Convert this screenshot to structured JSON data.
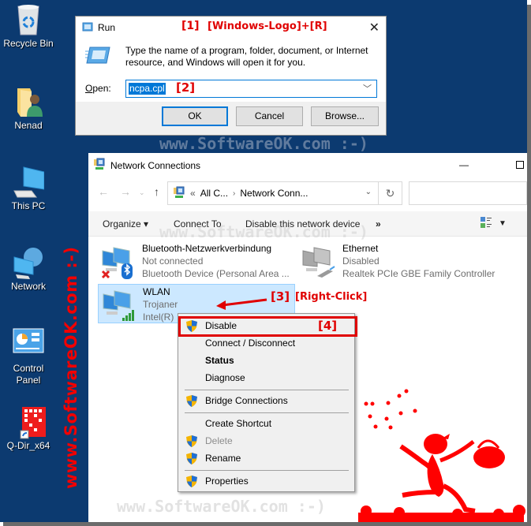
{
  "desktop": {
    "background_color": "#0c3a70",
    "icons": [
      {
        "label": "Recycle Bin",
        "icon": "recycle-bin-icon"
      },
      {
        "label": "Nenad",
        "icon": "user-folder-icon"
      },
      {
        "label": "This PC",
        "icon": "computer-icon"
      },
      {
        "label": "Network",
        "icon": "network-icon"
      },
      {
        "label": "Control Panel",
        "icon": "control-panel-icon"
      },
      {
        "label": "Q-Dir_x64",
        "icon": "qdir-shortcut-icon"
      }
    ]
  },
  "watermarks": {
    "side": "www.SoftwareOK.com :-)",
    "center": "www.SoftwareOK.com :-)"
  },
  "annotations": {
    "step1": "[1]",
    "step1_keys": "[Windows-Logo]+[R]",
    "step2": "[2]",
    "step3": "[3]",
    "step3_action": "[Right-Click]",
    "step4": "[4]",
    "color": "#e00000"
  },
  "run_dialog": {
    "title": "Run",
    "description": "Type the name of a program, folder, document, or Internet resource, and Windows will open it for you.",
    "open_label": "Open:",
    "open_value": "ncpa.cpl",
    "ok": "OK",
    "cancel": "Cancel",
    "browse": "Browse..."
  },
  "network_connections": {
    "title": "Network Connections",
    "address": {
      "overflow": "«",
      "crumb1": "All C...",
      "crumb2": "Network Conn..."
    },
    "search_placeholder": "",
    "commands": {
      "organize": "Organize ▾",
      "connect_to": "Connect To",
      "disable": "Disable this network device",
      "more": "»"
    },
    "connections": [
      {
        "name": "Bluetooth-Netzwerkverbindung",
        "status": "Not connected",
        "device": "Bluetooth Device (Personal Area ...",
        "selected": false
      },
      {
        "name": "Ethernet",
        "status": "Disabled",
        "device": "Realtek PCIe GBE Family Controller",
        "selected": false
      },
      {
        "name": "WLAN",
        "status": "Trojaner",
        "device": "Intel(R)",
        "selected": true
      }
    ]
  },
  "context_menu": {
    "items": [
      {
        "label": "Disable",
        "shield": true,
        "highlighted": true
      },
      {
        "label": "Connect / Disconnect",
        "shield": false
      },
      {
        "label": "Status",
        "shield": false,
        "bold": true
      },
      {
        "label": "Diagnose",
        "shield": false
      },
      {
        "label": "Bridge Connections",
        "shield": true
      },
      {
        "label": "Create Shortcut",
        "shield": false
      },
      {
        "label": "Delete",
        "shield": true,
        "disabled": true
      },
      {
        "label": "Rename",
        "shield": true
      },
      {
        "label": "Properties",
        "shield": true
      }
    ]
  }
}
